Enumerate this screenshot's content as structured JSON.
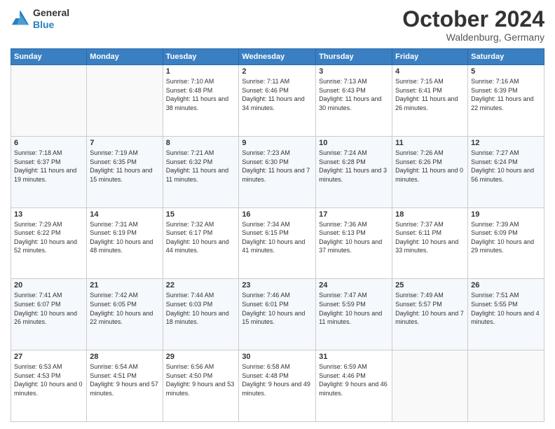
{
  "logo": {
    "general": "General",
    "blue": "Blue"
  },
  "header": {
    "month": "October 2024",
    "location": "Waldenburg, Germany"
  },
  "weekdays": [
    "Sunday",
    "Monday",
    "Tuesday",
    "Wednesday",
    "Thursday",
    "Friday",
    "Saturday"
  ],
  "weeks": [
    [
      {
        "day": "",
        "sunrise": "",
        "sunset": "",
        "daylight": ""
      },
      {
        "day": "",
        "sunrise": "",
        "sunset": "",
        "daylight": ""
      },
      {
        "day": "1",
        "sunrise": "Sunrise: 7:10 AM",
        "sunset": "Sunset: 6:48 PM",
        "daylight": "Daylight: 11 hours and 38 minutes."
      },
      {
        "day": "2",
        "sunrise": "Sunrise: 7:11 AM",
        "sunset": "Sunset: 6:46 PM",
        "daylight": "Daylight: 11 hours and 34 minutes."
      },
      {
        "day": "3",
        "sunrise": "Sunrise: 7:13 AM",
        "sunset": "Sunset: 6:43 PM",
        "daylight": "Daylight: 11 hours and 30 minutes."
      },
      {
        "day": "4",
        "sunrise": "Sunrise: 7:15 AM",
        "sunset": "Sunset: 6:41 PM",
        "daylight": "Daylight: 11 hours and 26 minutes."
      },
      {
        "day": "5",
        "sunrise": "Sunrise: 7:16 AM",
        "sunset": "Sunset: 6:39 PM",
        "daylight": "Daylight: 11 hours and 22 minutes."
      }
    ],
    [
      {
        "day": "6",
        "sunrise": "Sunrise: 7:18 AM",
        "sunset": "Sunset: 6:37 PM",
        "daylight": "Daylight: 11 hours and 19 minutes."
      },
      {
        "day": "7",
        "sunrise": "Sunrise: 7:19 AM",
        "sunset": "Sunset: 6:35 PM",
        "daylight": "Daylight: 11 hours and 15 minutes."
      },
      {
        "day": "8",
        "sunrise": "Sunrise: 7:21 AM",
        "sunset": "Sunset: 6:32 PM",
        "daylight": "Daylight: 11 hours and 11 minutes."
      },
      {
        "day": "9",
        "sunrise": "Sunrise: 7:23 AM",
        "sunset": "Sunset: 6:30 PM",
        "daylight": "Daylight: 11 hours and 7 minutes."
      },
      {
        "day": "10",
        "sunrise": "Sunrise: 7:24 AM",
        "sunset": "Sunset: 6:28 PM",
        "daylight": "Daylight: 11 hours and 3 minutes."
      },
      {
        "day": "11",
        "sunrise": "Sunrise: 7:26 AM",
        "sunset": "Sunset: 6:26 PM",
        "daylight": "Daylight: 11 hours and 0 minutes."
      },
      {
        "day": "12",
        "sunrise": "Sunrise: 7:27 AM",
        "sunset": "Sunset: 6:24 PM",
        "daylight": "Daylight: 10 hours and 56 minutes."
      }
    ],
    [
      {
        "day": "13",
        "sunrise": "Sunrise: 7:29 AM",
        "sunset": "Sunset: 6:22 PM",
        "daylight": "Daylight: 10 hours and 52 minutes."
      },
      {
        "day": "14",
        "sunrise": "Sunrise: 7:31 AM",
        "sunset": "Sunset: 6:19 PM",
        "daylight": "Daylight: 10 hours and 48 minutes."
      },
      {
        "day": "15",
        "sunrise": "Sunrise: 7:32 AM",
        "sunset": "Sunset: 6:17 PM",
        "daylight": "Daylight: 10 hours and 44 minutes."
      },
      {
        "day": "16",
        "sunrise": "Sunrise: 7:34 AM",
        "sunset": "Sunset: 6:15 PM",
        "daylight": "Daylight: 10 hours and 41 minutes."
      },
      {
        "day": "17",
        "sunrise": "Sunrise: 7:36 AM",
        "sunset": "Sunset: 6:13 PM",
        "daylight": "Daylight: 10 hours and 37 minutes."
      },
      {
        "day": "18",
        "sunrise": "Sunrise: 7:37 AM",
        "sunset": "Sunset: 6:11 PM",
        "daylight": "Daylight: 10 hours and 33 minutes."
      },
      {
        "day": "19",
        "sunrise": "Sunrise: 7:39 AM",
        "sunset": "Sunset: 6:09 PM",
        "daylight": "Daylight: 10 hours and 29 minutes."
      }
    ],
    [
      {
        "day": "20",
        "sunrise": "Sunrise: 7:41 AM",
        "sunset": "Sunset: 6:07 PM",
        "daylight": "Daylight: 10 hours and 26 minutes."
      },
      {
        "day": "21",
        "sunrise": "Sunrise: 7:42 AM",
        "sunset": "Sunset: 6:05 PM",
        "daylight": "Daylight: 10 hours and 22 minutes."
      },
      {
        "day": "22",
        "sunrise": "Sunrise: 7:44 AM",
        "sunset": "Sunset: 6:03 PM",
        "daylight": "Daylight: 10 hours and 18 minutes."
      },
      {
        "day": "23",
        "sunrise": "Sunrise: 7:46 AM",
        "sunset": "Sunset: 6:01 PM",
        "daylight": "Daylight: 10 hours and 15 minutes."
      },
      {
        "day": "24",
        "sunrise": "Sunrise: 7:47 AM",
        "sunset": "Sunset: 5:59 PM",
        "daylight": "Daylight: 10 hours and 11 minutes."
      },
      {
        "day": "25",
        "sunrise": "Sunrise: 7:49 AM",
        "sunset": "Sunset: 5:57 PM",
        "daylight": "Daylight: 10 hours and 7 minutes."
      },
      {
        "day": "26",
        "sunrise": "Sunrise: 7:51 AM",
        "sunset": "Sunset: 5:55 PM",
        "daylight": "Daylight: 10 hours and 4 minutes."
      }
    ],
    [
      {
        "day": "27",
        "sunrise": "Sunrise: 6:53 AM",
        "sunset": "Sunset: 4:53 PM",
        "daylight": "Daylight: 10 hours and 0 minutes."
      },
      {
        "day": "28",
        "sunrise": "Sunrise: 6:54 AM",
        "sunset": "Sunset: 4:51 PM",
        "daylight": "Daylight: 9 hours and 57 minutes."
      },
      {
        "day": "29",
        "sunrise": "Sunrise: 6:56 AM",
        "sunset": "Sunset: 4:50 PM",
        "daylight": "Daylight: 9 hours and 53 minutes."
      },
      {
        "day": "30",
        "sunrise": "Sunrise: 6:58 AM",
        "sunset": "Sunset: 4:48 PM",
        "daylight": "Daylight: 9 hours and 49 minutes."
      },
      {
        "day": "31",
        "sunrise": "Sunrise: 6:59 AM",
        "sunset": "Sunset: 4:46 PM",
        "daylight": "Daylight: 9 hours and 46 minutes."
      },
      {
        "day": "",
        "sunrise": "",
        "sunset": "",
        "daylight": ""
      },
      {
        "day": "",
        "sunrise": "",
        "sunset": "",
        "daylight": ""
      }
    ]
  ]
}
